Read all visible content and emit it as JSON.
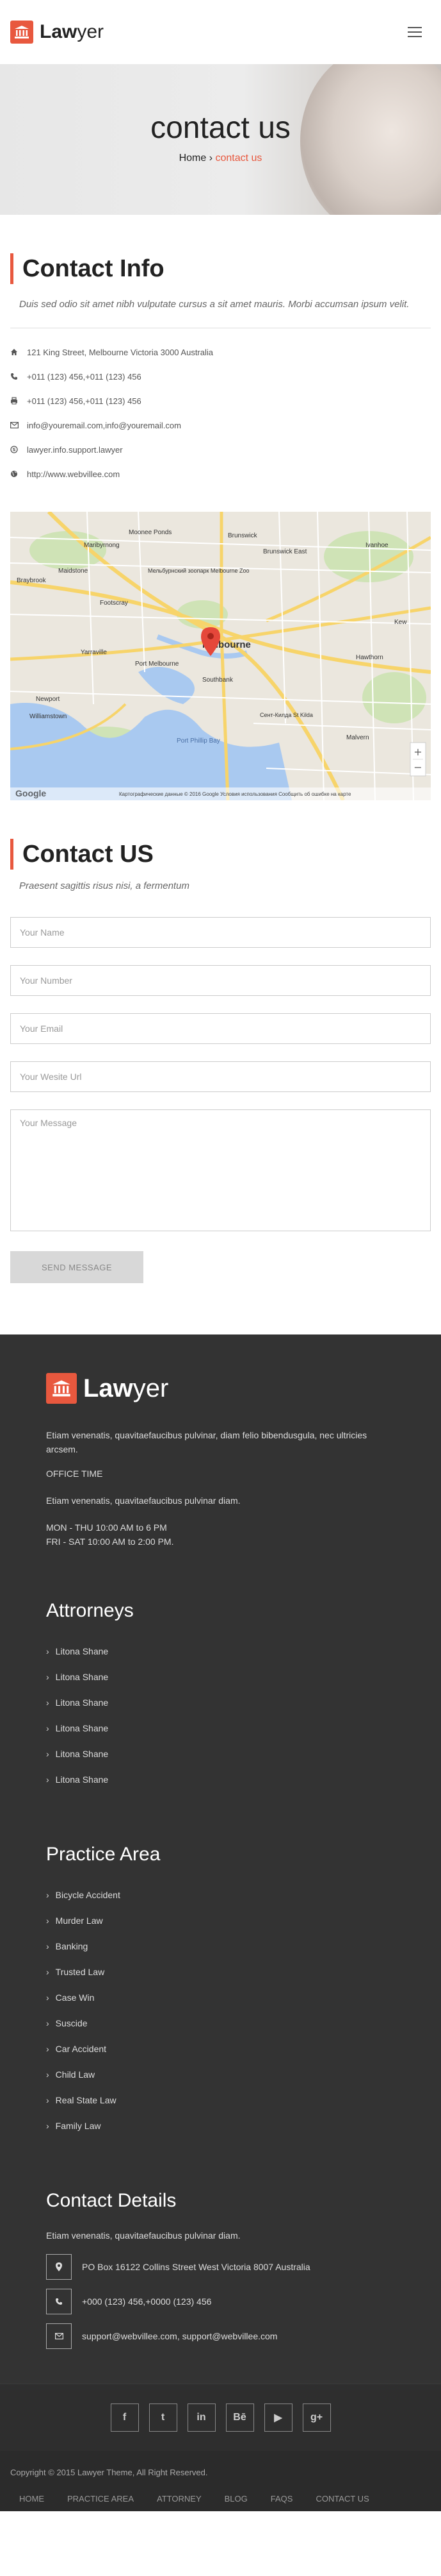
{
  "brand": {
    "name_bold": "Law",
    "name_rest": "yer"
  },
  "hero": {
    "title": "contact us",
    "crumb_home": "Home",
    "crumb_sep": " › ",
    "crumb_current": "contact us"
  },
  "contact_info": {
    "heading_bold": "Contact",
    "heading_rest": " Info",
    "lead": "Duis sed odio sit amet nibh vulputate cursus a sit amet mauris. Morbi accumsan ipsum velit.",
    "items": [
      {
        "icon": "home-icon",
        "text": "121 King Street, Melbourne Victoria 3000 Australia"
      },
      {
        "icon": "phone-icon",
        "text": "+011 (123) 456,+011 (123) 456"
      },
      {
        "icon": "fax-icon",
        "text": "+011 (123) 456,+011 (123) 456"
      },
      {
        "icon": "mail-icon",
        "text": "info@youremail.com,info@youremail.com"
      },
      {
        "icon": "skype-icon",
        "text": "lawyer.info.support.lawyer"
      },
      {
        "icon": "globe-icon",
        "text": "http://www.webvillee.com"
      }
    ]
  },
  "map": {
    "labels": {
      "moonee_ponds": "Moonee Ponds",
      "maribyrnong": "Maribyrnong",
      "brunswick": "Brunswick",
      "brunswick_east": "Brunswick East",
      "ivanhoe": "Ivanhoe",
      "zoo": "Мельбурнский зоопарк Melbourne Zoo",
      "braybrook": "Braybrook",
      "maidstone": "Maidstone",
      "footscray": "Footscray",
      "kew": "Kew",
      "yarraville": "Yarraville",
      "port_melbourne": "Port Melbourne",
      "melbourne": "Melbourne",
      "southbank": "Southbank",
      "hawthorn": "Hawthorn",
      "newport": "Newport",
      "williamstown": "Williamstown",
      "port_phillip": "Port Phillip Bay",
      "st_kilda": "Сент-Килда St Kilda",
      "malvern": "Malvern",
      "google": "Google",
      "attribution": "Картографические данные © 2016 Google   Условия использования   Сообщить об ошибке на карте"
    }
  },
  "contact_us": {
    "heading_bold": "Contact",
    "heading_rest": " US",
    "lead": "Praesent sagittis risus nisi, a fermentum",
    "name_placeholder": "Your Name",
    "number_placeholder": "Your Number",
    "email_placeholder": "Your Email",
    "website_placeholder": "Your Wesite Url",
    "message_placeholder": "Your Message",
    "send_label": "SEND MESSAGE"
  },
  "footer": {
    "about": "Etiam venenatis, quavitaefaucibus pulvinar, diam felio bibendusgula, nec ultricies arcsem.",
    "office_time_label": "OFFICE TIME",
    "office_text": "Etiam venenatis, quavitaefaucibus pulvinar diam.",
    "hours": [
      "MON - THU 10:00 AM to 6 PM",
      "FRI - SAT 10:00 AM to 2:00 PM."
    ],
    "attorneys_heading": "Attrorneys",
    "attorneys": [
      "Litona Shane",
      "Litona Shane",
      "Litona Shane",
      "Litona Shane",
      "Litona Shane",
      "Litona Shane"
    ],
    "practice_heading": "Practice Area",
    "practice": [
      "Bicycle Accident",
      "Murder Law",
      "Banking",
      "Trusted Law",
      "Case Win",
      "Suscide",
      "Car Accident",
      "Child Law",
      "Real State Law",
      "Family Law"
    ],
    "details_heading": "Contact Details",
    "details_text": "Etiam venenatis, quavitaefaucibus pulvinar diam.",
    "details": [
      {
        "icon": "map-pin-icon",
        "text": "PO Box 16122 Collins Street West Victoria 8007 Australia"
      },
      {
        "icon": "phone-icon",
        "text": "+000 (123) 456,+0000 (123) 456"
      },
      {
        "icon": "mail-icon",
        "text": "support@webvillee.com, support@webvillee.com"
      }
    ],
    "social": [
      "f",
      "t",
      "in",
      "Bē",
      "▶",
      "g+"
    ],
    "copyright": "Copyright © 2015 Lawyer Theme, All Right Reserved.",
    "nav": [
      "HOME",
      "PRACTICE AREA",
      "ATTORNEY",
      "BLOG",
      "FAQS",
      "CONTACT US"
    ]
  },
  "colors": {
    "accent": "#e8583e",
    "footer_bg": "#333333"
  }
}
